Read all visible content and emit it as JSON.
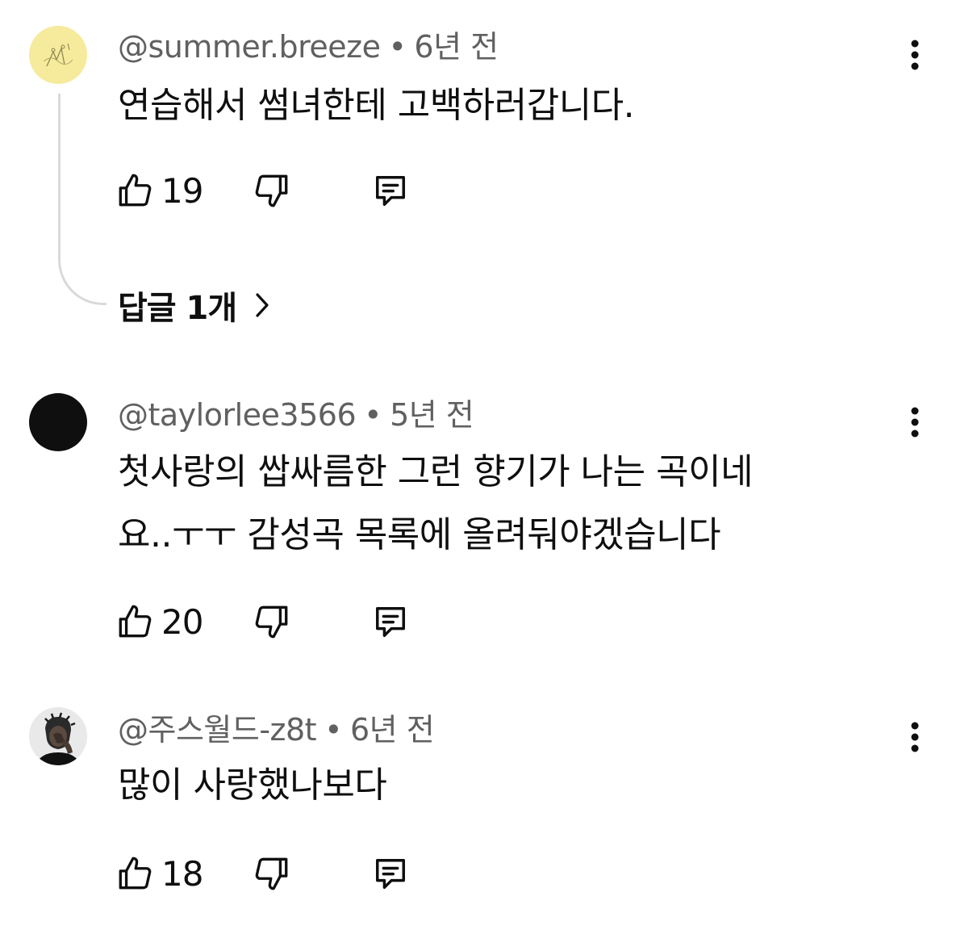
{
  "comments": [
    {
      "author": "@summer.breeze",
      "time": "6년 전",
      "text": "연습해서 썸녀한테 고백하러갑니다.",
      "likes": "19",
      "replies_label": "답글 1개",
      "avatar": "yellow-sketch-avatar"
    },
    {
      "author": "@taylorlee3566",
      "time": "5년 전",
      "text_line1": "첫사랑의 쌉싸름한 그런 향기가 나는 곡이네",
      "text_line2": "요..ㅜㅜ 감성곡 목록에 올려둬야겠습니다",
      "likes": "20",
      "avatar": "black-circle-avatar"
    },
    {
      "author": "@주스월드-z8t",
      "time": "6년 전",
      "text": "많이 사랑했나보다",
      "likes": "18",
      "avatar": "person-photo-avatar"
    }
  ],
  "separator": "•",
  "icons": {
    "like": "thumbs-up-icon",
    "dislike": "thumbs-down-icon",
    "reply": "reply-comment-icon",
    "more": "more-vertical-icon",
    "chevron": "chevron-right-icon"
  },
  "colors": {
    "text": "#0f0f0f",
    "meta": "#606060",
    "thread_line": "#d9d9d9"
  }
}
